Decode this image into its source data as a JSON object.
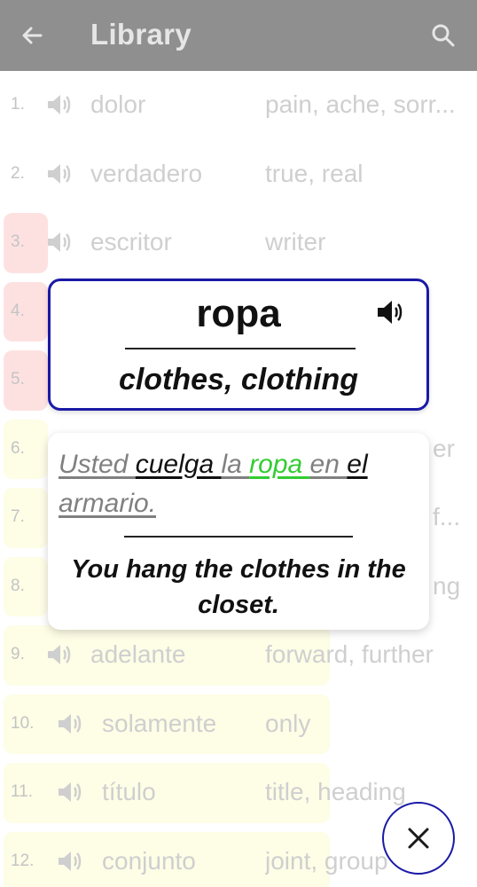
{
  "header": {
    "title": "Library",
    "back_icon": "arrow-left-icon",
    "search_icon": "search-icon"
  },
  "colors": {
    "header": "#8f8f8f",
    "red_row": "#fde1e1",
    "yellow_row": "#fefde6",
    "card_border": "#1a1aa6",
    "highlight": "#33cc33"
  },
  "list": {
    "rows": [
      {
        "num": "1.",
        "word": "dolor",
        "trans": "pain, ache, sorr..."
      },
      {
        "num": "2.",
        "word": "verdadero",
        "trans": "true, real"
      },
      {
        "num": "3.",
        "word": "escritor",
        "trans": "writer"
      },
      {
        "num": "4.",
        "word": "",
        "trans": ""
      },
      {
        "num": "5.",
        "word": "",
        "trans": ""
      },
      {
        "num": "6.",
        "word": "",
        "trans": "er"
      },
      {
        "num": "7.",
        "word": "",
        "trans": "f..."
      },
      {
        "num": "8.",
        "word": "",
        "trans": "ng"
      },
      {
        "num": "9.",
        "word": "adelante",
        "trans": "forward, further"
      },
      {
        "num": "10.",
        "word": "solamente",
        "trans": "only"
      },
      {
        "num": "11.",
        "word": "título",
        "trans": "title, heading"
      },
      {
        "num": "12.",
        "word": "conjunto",
        "trans": "joint, group"
      }
    ]
  },
  "word_card": {
    "word": "ropa",
    "translation": "clothes, clothing",
    "speaker_icon": "speaker-icon"
  },
  "sentence_card": {
    "es_parts": [
      "Usted ",
      "cuelga ",
      "la ",
      "ropa ",
      "en ",
      "el",
      " armario. "
    ],
    "en": "You hang the clothes in the closet."
  },
  "close_button": {
    "icon": "close-icon"
  }
}
